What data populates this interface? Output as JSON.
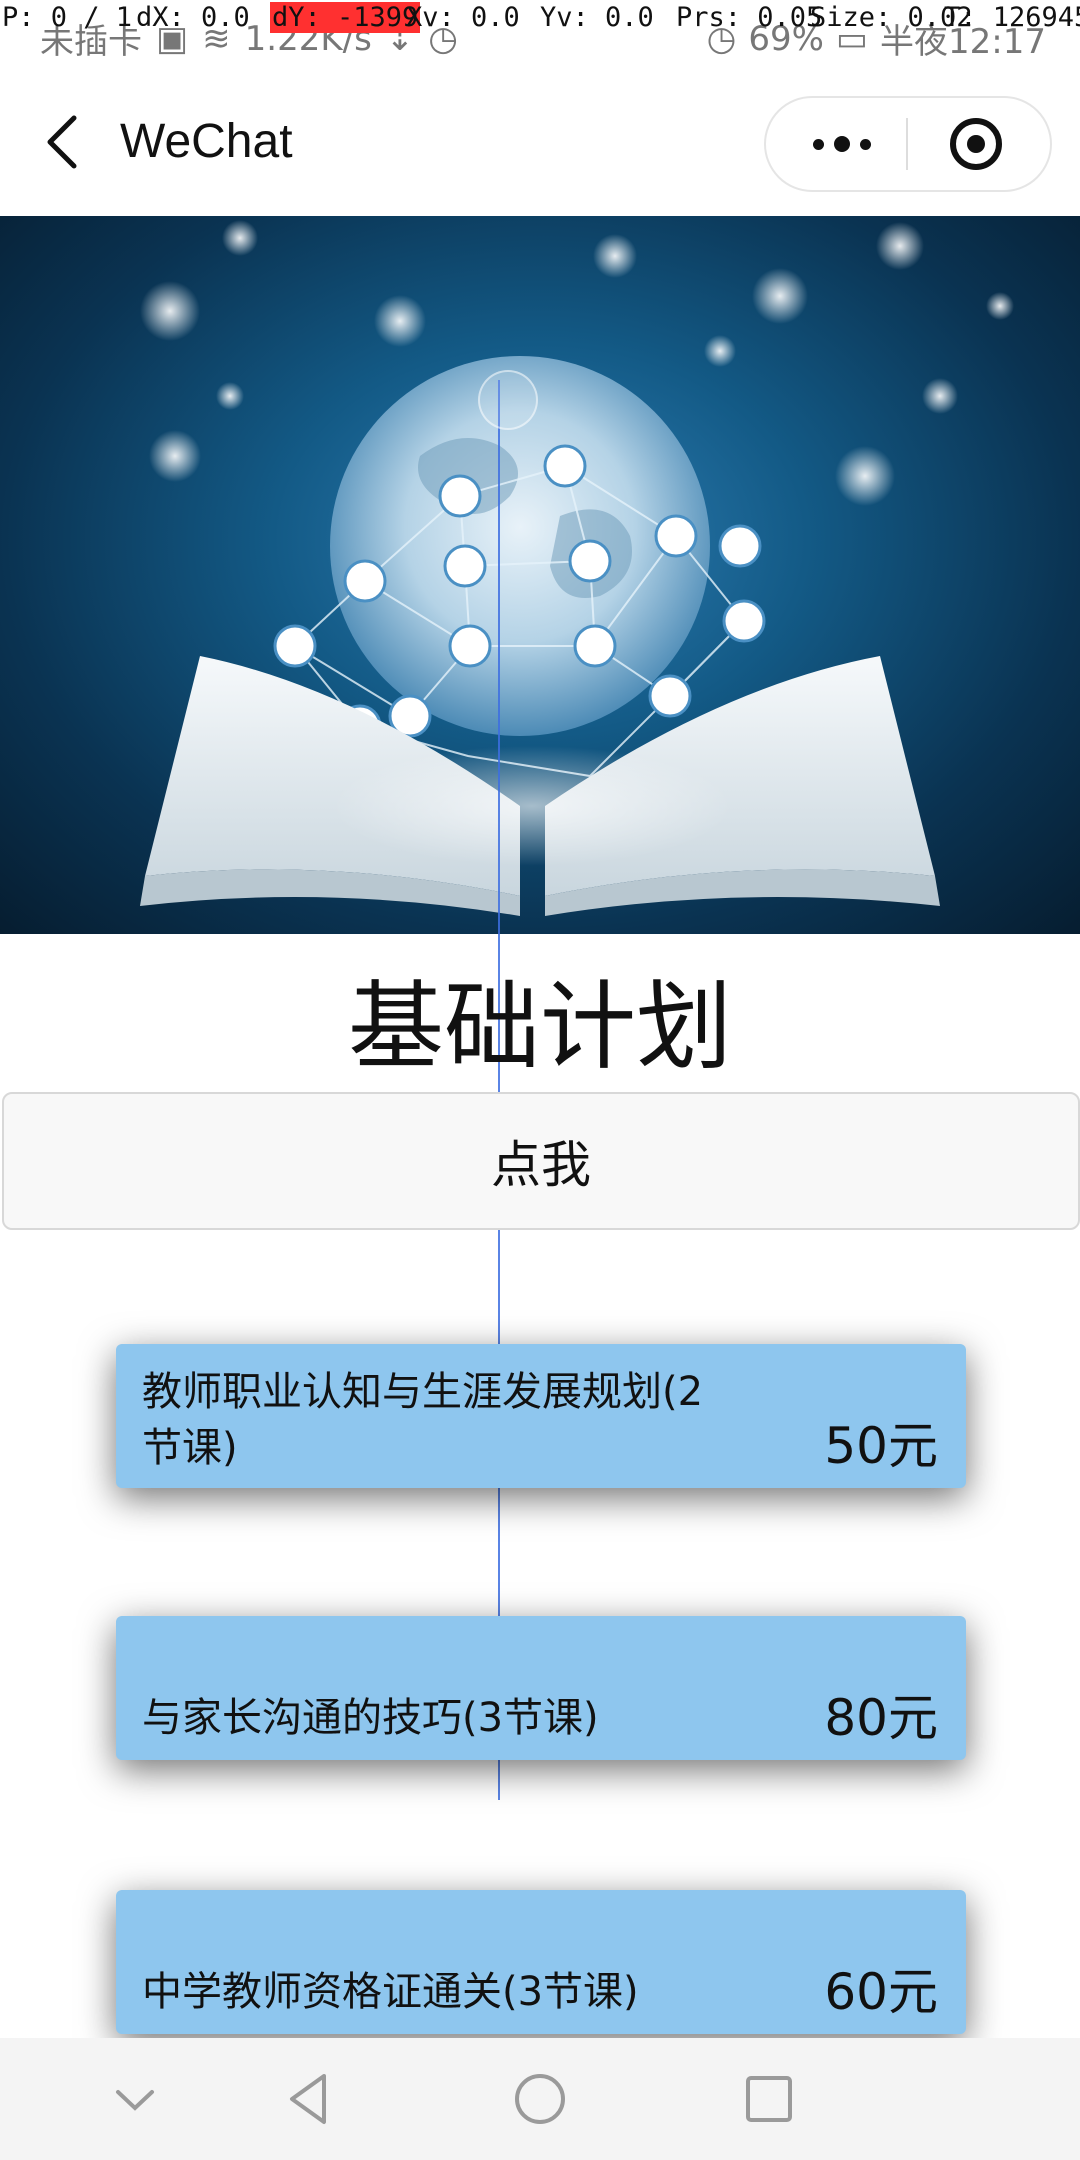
{
  "status_bar": {
    "carrier": "未插卡",
    "speed": "1.22K/s",
    "battery": "69%",
    "time": "半夜12:17"
  },
  "debug_overlay": {
    "p": "P: 0 / 1",
    "dx": "dX: 0.0",
    "dy": "dY: -1399",
    "xv": "Xv: 0.0",
    "yv": "Yv: 0.0",
    "prs": "Prs: 0.05",
    "size": "Size: 0.02",
    "t": "T: 126945"
  },
  "navbar": {
    "title": "WeChat",
    "back_icon": "chevron-left-icon",
    "more_icon": "more-dots-icon",
    "close_icon": "target-icon"
  },
  "main": {
    "title": "基础计划",
    "button_label": "点我",
    "courses": [
      {
        "name": "教师职业认知与生涯发展规划(2节课)",
        "price": "50元"
      },
      {
        "name": "与家长沟通的技巧(3节课)",
        "price": "80元"
      },
      {
        "name": "中学教师资格证通关(3节课)",
        "price": "60元"
      }
    ]
  },
  "colors": {
    "card_bg": "#8ec6ee",
    "hero_dark": "#0a3352",
    "hero_light": "#2f7fb5"
  }
}
